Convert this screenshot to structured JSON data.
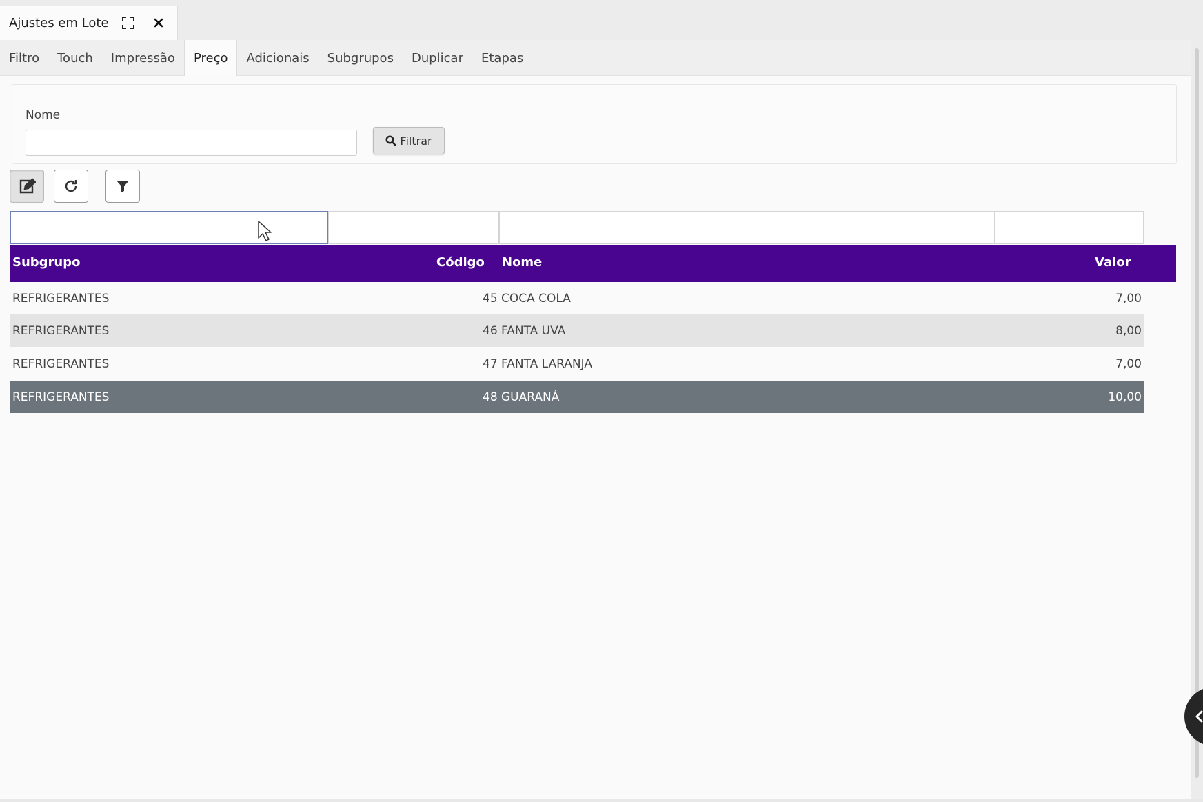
{
  "window": {
    "title": "Ajustes em Lote"
  },
  "tabs": [
    {
      "label": "Filtro"
    },
    {
      "label": "Touch"
    },
    {
      "label": "Impressão"
    },
    {
      "label": "Preço",
      "active": true
    },
    {
      "label": "Adicionais"
    },
    {
      "label": "Subgrupos"
    },
    {
      "label": "Duplicar"
    },
    {
      "label": "Etapas"
    }
  ],
  "filter": {
    "label": "Nome",
    "value": "",
    "button_label": "Filtrar"
  },
  "toolbar": {
    "edit_icon": "edit-icon",
    "refresh_icon": "refresh-icon",
    "filter_icon": "funnel-icon"
  },
  "grid": {
    "columns": [
      "Subgrupo",
      "Código",
      "Nome",
      "Valor"
    ],
    "rows": [
      {
        "subgrupo": "REFRIGERANTES",
        "codigo": "45",
        "nome": "COCA COLA",
        "valor": "7,00"
      },
      {
        "subgrupo": "REFRIGERANTES",
        "codigo": "46",
        "nome": "FANTA UVA",
        "valor": "8,00"
      },
      {
        "subgrupo": "REFRIGERANTES",
        "codigo": "47",
        "nome": "FANTA LARANJA",
        "valor": "7,00"
      },
      {
        "subgrupo": "REFRIGERANTES",
        "codigo": "48",
        "nome": "GUARANÁ",
        "valor": "10,00"
      }
    ],
    "selected_row": 3
  },
  "colors": {
    "header_bg": "#4a0590",
    "selected_row_bg": "#6c747c",
    "alt_row_bg": "#e4e4e4"
  }
}
